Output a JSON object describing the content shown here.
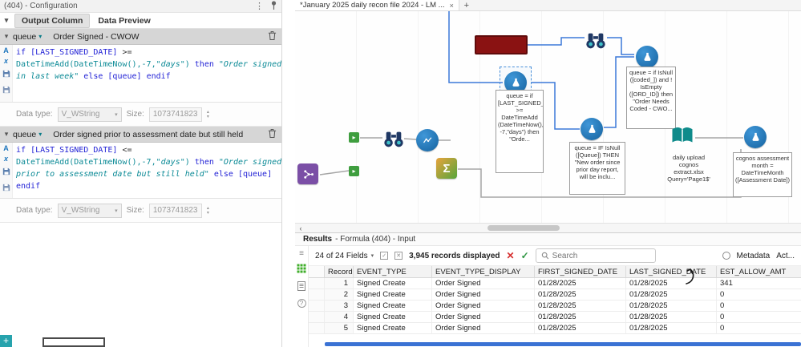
{
  "icons": {
    "kebab": "⋮",
    "chevron": "▾",
    "caret": "▾",
    "close": "×",
    "plus": "+",
    "add": "+",
    "sigma": "Σ",
    "arrow": "▸",
    "scroll_left": "‹",
    "check": "✓",
    "cross": "✕",
    "list": "≡",
    "question": "?",
    "spin_up": "▴",
    "spin_down": "▾",
    "insert_field": "A",
    "insert_function": "x"
  },
  "config": {
    "title": "(404) - Configuration",
    "tabs": [
      {
        "label": "Output Column"
      },
      {
        "label": "Data Preview"
      }
    ],
    "labels": {
      "data_type": "Data type:",
      "size": "Size:"
    },
    "blocks": [
      {
        "field": "queue",
        "description": "Order Signed - CWOW",
        "data_type": "V_WString",
        "size": "1073741823",
        "code": [
          [
            {
              "t": "if ",
              "c": "kw"
            },
            {
              "t": "[LAST_SIGNED_DATE]",
              "c": "field"
            },
            {
              "t": " >=",
              "c": "op"
            }
          ],
          [
            {
              "t": "DateTimeAdd(DateTimeNow(),-7,",
              "c": "fn"
            },
            {
              "t": "\"days\"",
              "c": "str"
            },
            {
              "t": ")",
              "c": "fn"
            },
            {
              "t": " then ",
              "c": "kw"
            },
            {
              "t": "\"Order signed",
              "c": "str"
            }
          ],
          [
            {
              "t": "in last week\"",
              "c": "str"
            },
            {
              "t": " else ",
              "c": "kw"
            },
            {
              "t": "[queue]",
              "c": "field"
            },
            {
              "t": " endif",
              "c": "kw"
            }
          ]
        ]
      },
      {
        "field": "queue",
        "description": "Order signed prior to assessment date but still held",
        "data_type": "V_WString",
        "size": "1073741823",
        "code": [
          [
            {
              "t": "if ",
              "c": "kw"
            },
            {
              "t": "[LAST_SIGNED_DATE]",
              "c": "field"
            },
            {
              "t": " <=",
              "c": "op"
            }
          ],
          [
            {
              "t": "DateTimeAdd(DateTimeNow(),-7,",
              "c": "fn"
            },
            {
              "t": "\"days\"",
              "c": "str"
            },
            {
              "t": ")",
              "c": "fn"
            },
            {
              "t": " then ",
              "c": "kw"
            },
            {
              "t": "\"Order signed",
              "c": "str"
            }
          ],
          [
            {
              "t": "prior to assessment date but still held\"",
              "c": "str"
            },
            {
              "t": " else ",
              "c": "kw"
            },
            {
              "t": "[queue]",
              "c": "field"
            }
          ],
          [
            {
              "t": "endif",
              "c": "kw"
            }
          ]
        ]
      }
    ]
  },
  "canvas": {
    "tab": {
      "title": "*January 2025 daily recon file 2024 - LM ..."
    },
    "annotations": {
      "a1": "queue = if [LAST_SIGNED_DATE] >= DateTimeAdd (DateTimeNow(), -7,\"days\") then \"Orde...",
      "a2": "queue = IF IsNull ([Queue]) THEN \"New order since prior day report, will be inclu...",
      "a3": "queue = if IsNull ([coded_]) and ! IsEmpty ([ORD_ID]) then \"Order Needs Coded - CWO...",
      "a4": "daily upload cognos extract.xlsx Query='Page1$'",
      "a5": "cognos assessment month = DateTimeMonth ([Assessment Date])"
    }
  },
  "results": {
    "title": "Results",
    "subtitle": "- Formula (404) - Input",
    "fields_button": "24 of 24 Fields",
    "records": "3,945 records displayed",
    "search_placeholder": "Search",
    "metadata_label": "Metadata",
    "actions_label": "Act...",
    "table": {
      "columns": [
        "Record",
        "EVENT_TYPE",
        "EVENT_TYPE_DISPLAY",
        "FIRST_SIGNED_DATE",
        "LAST_SIGNED_DATE",
        "EST_ALLOW_AMT"
      ],
      "rows": [
        [
          "1",
          "Signed Create",
          "Order Signed",
          "01/28/2025",
          "01/28/2025",
          "341"
        ],
        [
          "2",
          "Signed Create",
          "Order Signed",
          "01/28/2025",
          "01/28/2025",
          "0"
        ],
        [
          "3",
          "Signed Create",
          "Order Signed",
          "01/28/2025",
          "01/28/2025",
          "0"
        ],
        [
          "4",
          "Signed Create",
          "Order Signed",
          "01/28/2025",
          "01/28/2025",
          "0"
        ],
        [
          "5",
          "Signed Create",
          "Order Signed",
          "01/28/2025",
          "01/28/2025",
          "0"
        ]
      ]
    }
  }
}
